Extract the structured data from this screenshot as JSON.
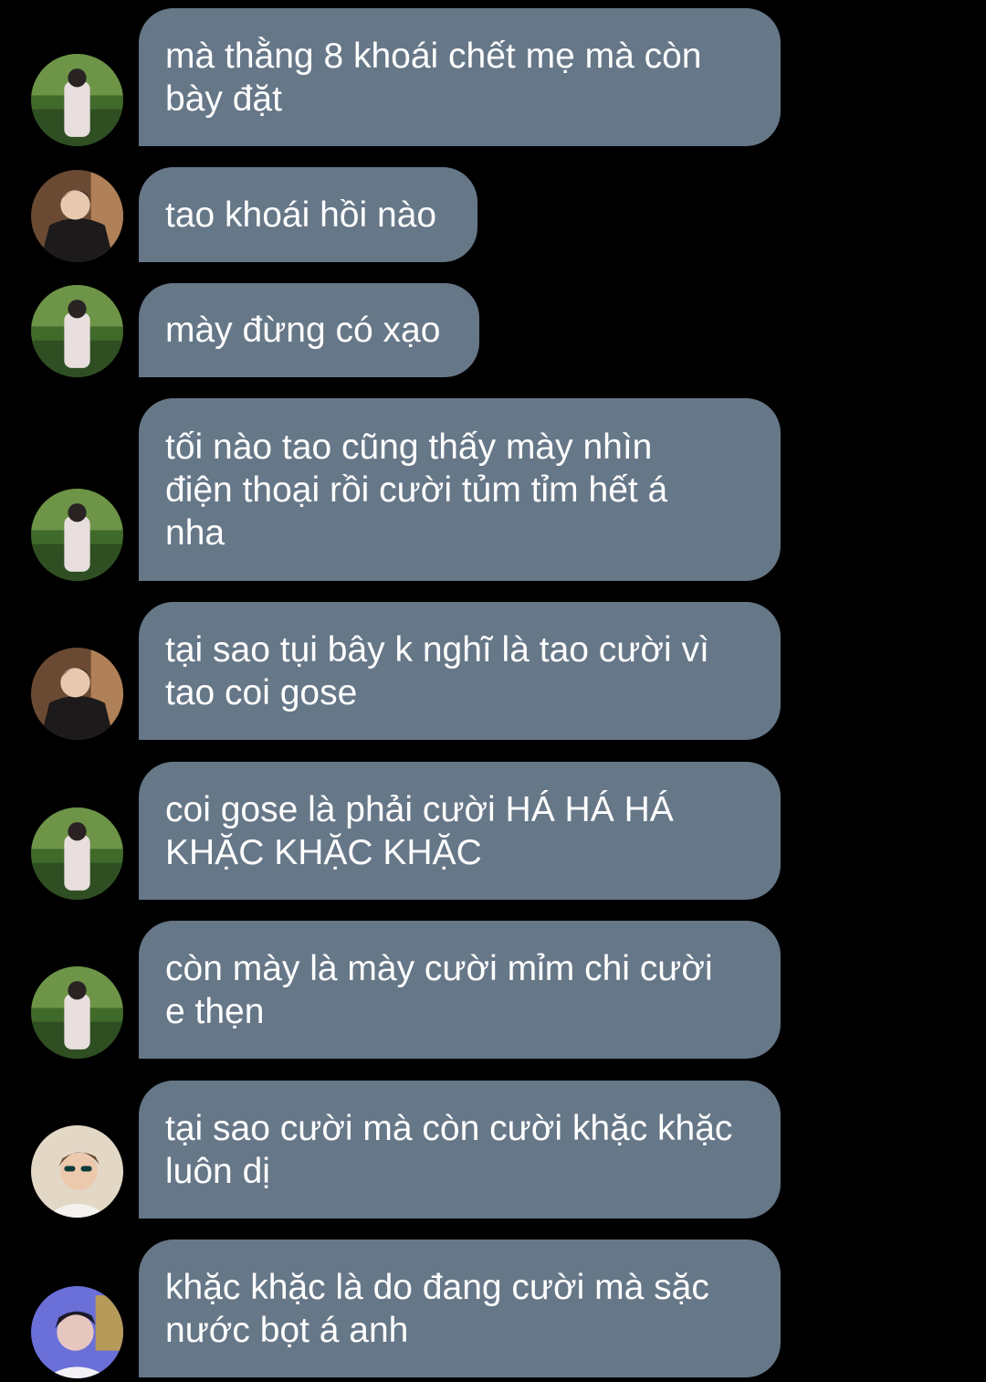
{
  "messages": [
    {
      "avatar": "avatar-garden-photo",
      "text": "mà thằng 8 khoái chết mẹ mà còn\nbày đặt"
    },
    {
      "avatar": "avatar-suit-photo",
      "text": "tao khoái hồi nào"
    },
    {
      "avatar": "avatar-garden-photo",
      "text": "mày đừng có xạo"
    },
    {
      "avatar": "avatar-garden-photo",
      "text": "tối nào tao cũng thấy mày nhìn\nđiện thoại rồi cười tủm tỉm hết á\nnha"
    },
    {
      "avatar": "avatar-suit-photo",
      "text": "tại sao tụi bây k nghĩ là tao cười vì\ntao coi gose"
    },
    {
      "avatar": "avatar-garden-photo",
      "text": "coi gose là phải cười HÁ HÁ HÁ\nKHẶC KHẶC KHẶC"
    },
    {
      "avatar": "avatar-garden-photo",
      "text": "còn mày là mày cười mỉm chi cười\ne thẹn"
    },
    {
      "avatar": "avatar-sunglasses-photo",
      "text": "tại sao cười mà còn cười khặc khặc\nluôn dị"
    },
    {
      "avatar": "avatar-blue-light-photo",
      "text": "khặc khặc là do đang cười mà sặc\nnước bọt á anh"
    }
  ],
  "colors": {
    "background": "#000000",
    "bubble": "#667788",
    "text": "#ffffff"
  }
}
